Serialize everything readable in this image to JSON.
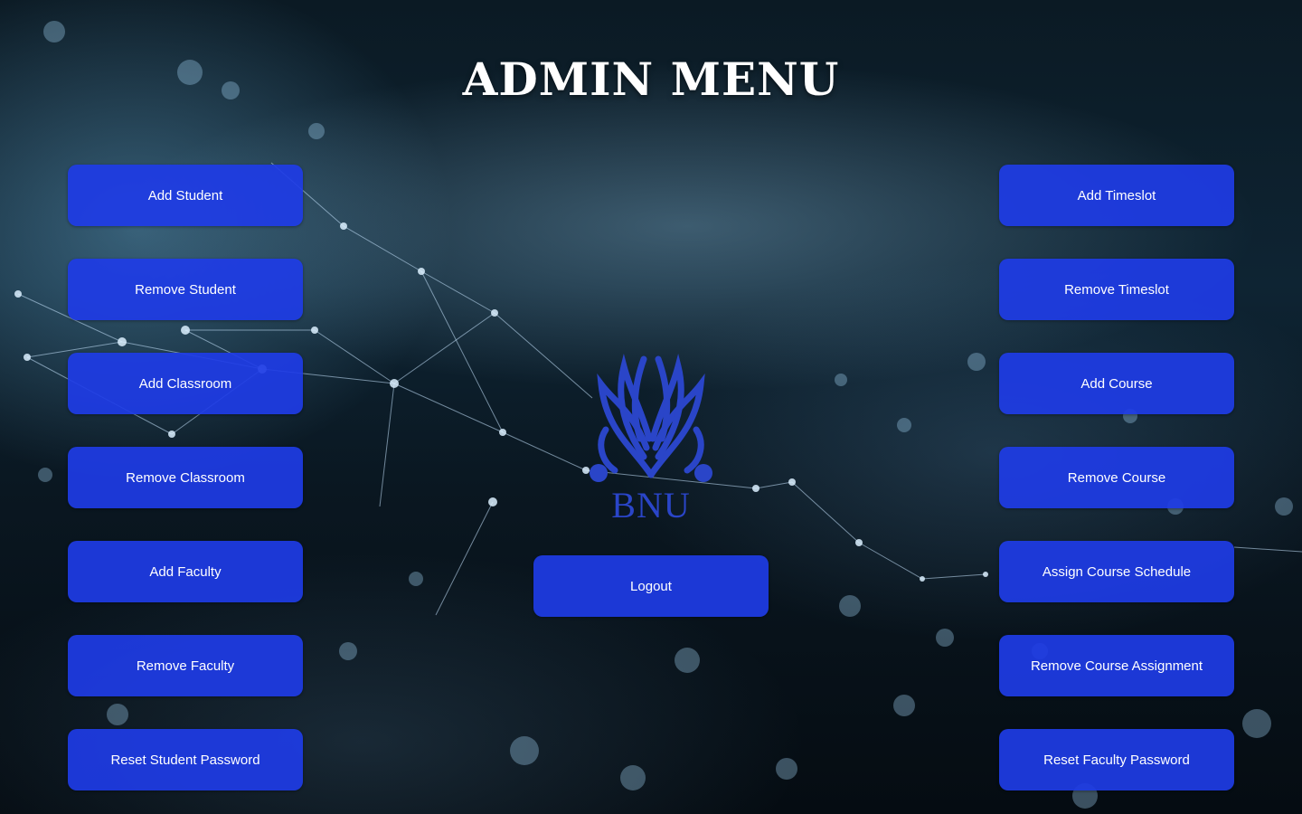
{
  "window": {
    "title": "ADMIN MENU"
  },
  "logo": {
    "text": "BNU"
  },
  "left_buttons": [
    {
      "label": "Add Student"
    },
    {
      "label": "Remove Student"
    },
    {
      "label": "Add Classroom"
    },
    {
      "label": "Remove Classroom"
    },
    {
      "label": "Add Faculty"
    },
    {
      "label": "Remove Faculty"
    },
    {
      "label": "Reset Student Password"
    }
  ],
  "right_buttons": [
    {
      "label": "Add Timeslot"
    },
    {
      "label": "Remove Timeslot"
    },
    {
      "label": "Add Course"
    },
    {
      "label": "Remove Course"
    },
    {
      "label": "Assign Course Schedule"
    },
    {
      "label": "Remove Course Assignment"
    },
    {
      "label": "Reset Faculty Password"
    }
  ],
  "logout": {
    "label": "Logout"
  },
  "colors": {
    "button_bg": "#1e3ce6",
    "title_text": "#ffffff",
    "logo": "#2a45c8"
  }
}
